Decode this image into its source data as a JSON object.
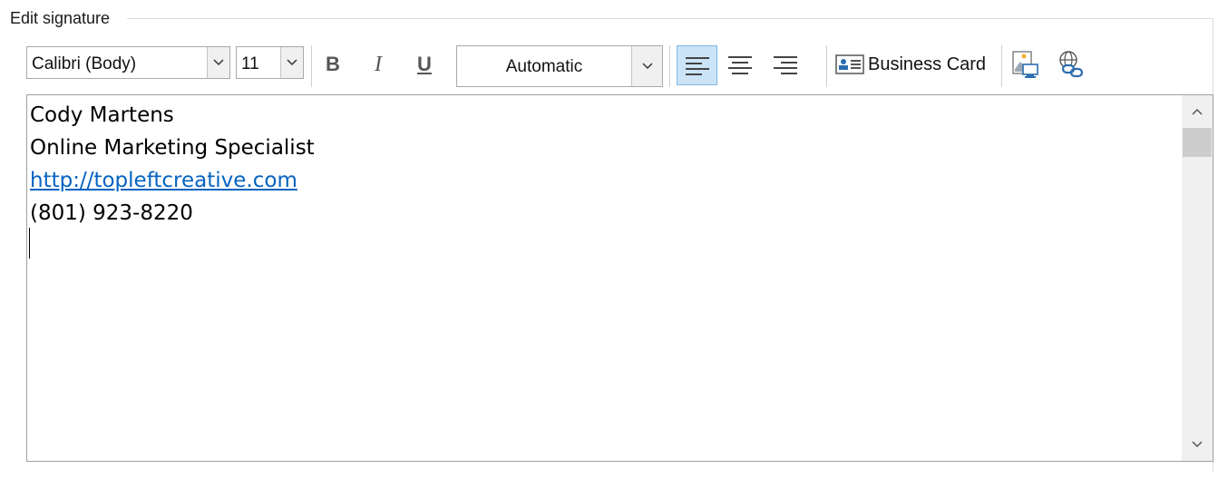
{
  "group": {
    "title": "Edit signature",
    "accesskey_char": "t"
  },
  "toolbar": {
    "font_name": "Calibri (Body)",
    "font_size": "11",
    "bold_label": "B",
    "italic_label": "I",
    "underline_label": "U",
    "color_value": "Automatic",
    "align_active": "left",
    "business_card_label": "Business Card",
    "business_card_accesskey": "B",
    "icons": {
      "insert_picture": "insert-picture-icon",
      "insert_hyperlink": "insert-hyperlink-icon"
    }
  },
  "editor": {
    "lines": [
      {
        "text": "Cody Martens",
        "type": "text"
      },
      {
        "text": "Online Marketing Specialist",
        "type": "text"
      },
      {
        "text": "http://topleftcreative.com",
        "type": "link"
      },
      {
        "text": "(801) 923-8220",
        "type": "text"
      }
    ],
    "link_color": "#0563c1"
  },
  "colors": {
    "active_button_bg": "#cce4f7",
    "active_button_border": "#7fb5e3"
  }
}
